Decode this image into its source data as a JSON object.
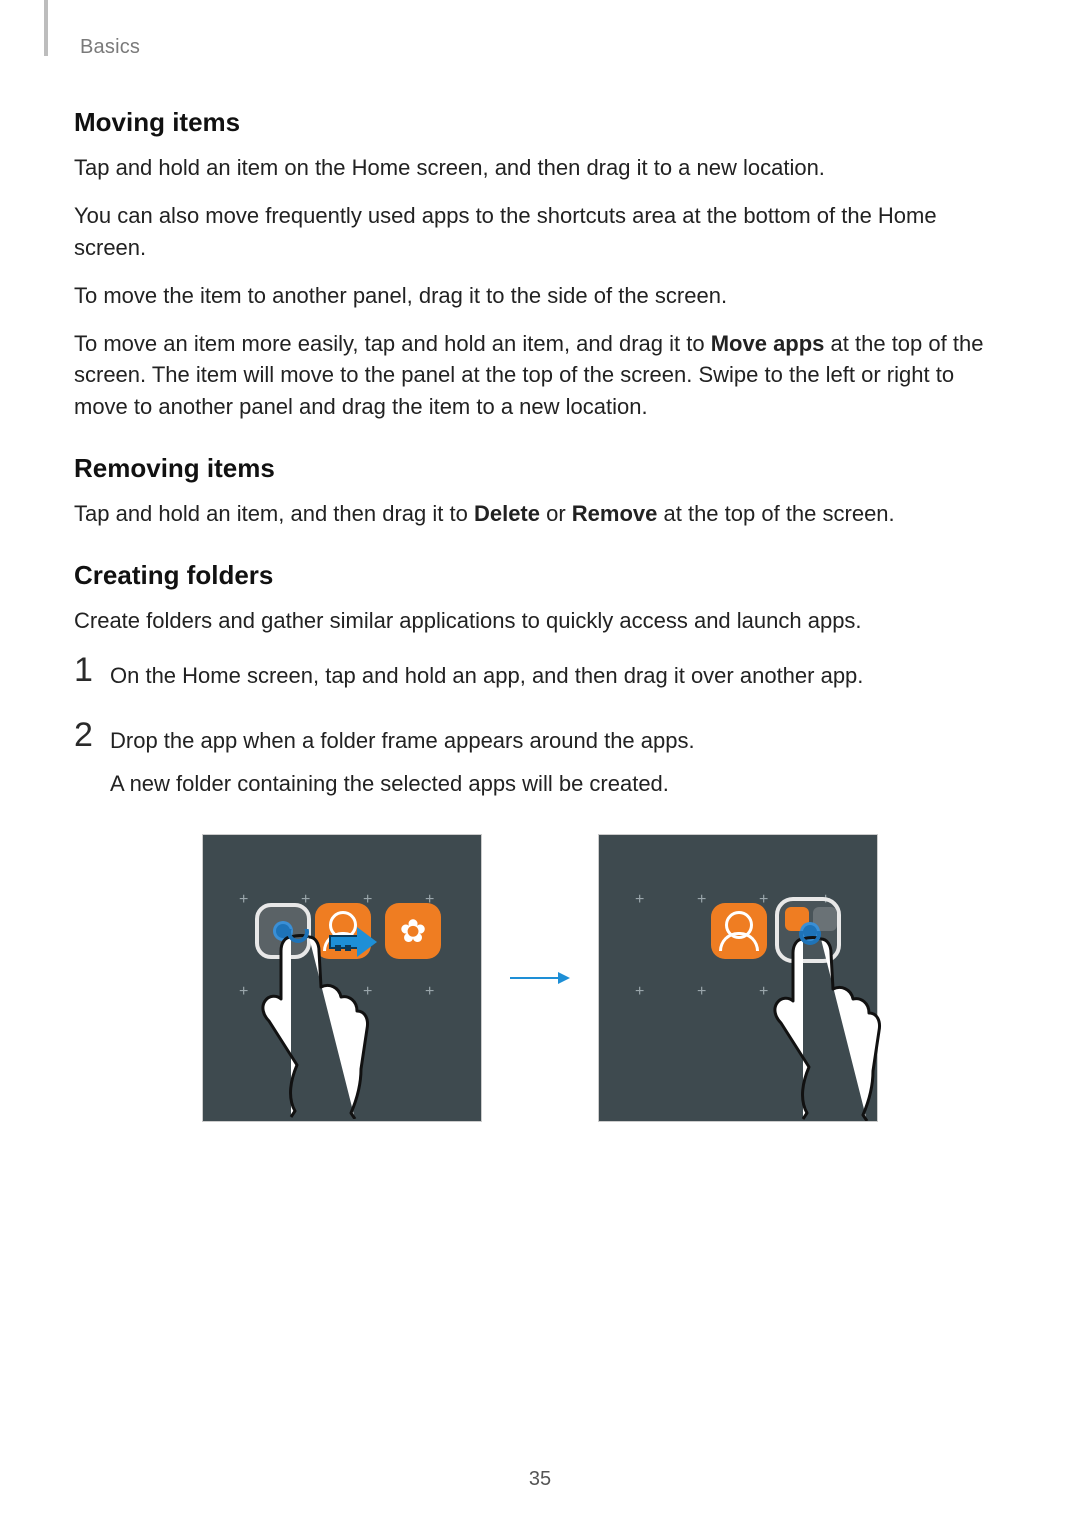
{
  "breadcrumb": "Basics",
  "sections": {
    "moving": {
      "heading": "Moving items",
      "p1": "Tap and hold an item on the Home screen, and then drag it to a new location.",
      "p2": "You can also move frequently used apps to the shortcuts area at the bottom of the Home screen.",
      "p3": "To move the item to another panel, drag it to the side of the screen.",
      "p4_pre": "To move an item more easily, tap and hold an item, and drag it to ",
      "p4_bold": "Move apps",
      "p4_post": " at the top of the screen. The item will move to the panel at the top of the screen. Swipe to the left or right to move to another panel and drag the item to a new location."
    },
    "removing": {
      "heading": "Removing items",
      "p1_pre": "Tap and hold an item, and then drag it to ",
      "p1_b1": "Delete",
      "p1_mid": " or ",
      "p1_b2": "Remove",
      "p1_post": " at the top of the screen."
    },
    "creating": {
      "heading": "Creating folders",
      "intro": "Create folders and gather similar applications to quickly access and launch apps.",
      "steps": [
        {
          "num": "1",
          "text": "On the Home screen, tap and hold an app, and then drag it over another app."
        },
        {
          "num": "2",
          "text": "Drop the app when a folder frame appears around the apps.",
          "text2": "A new folder containing the selected apps will be created."
        }
      ]
    }
  },
  "page_number": "35"
}
